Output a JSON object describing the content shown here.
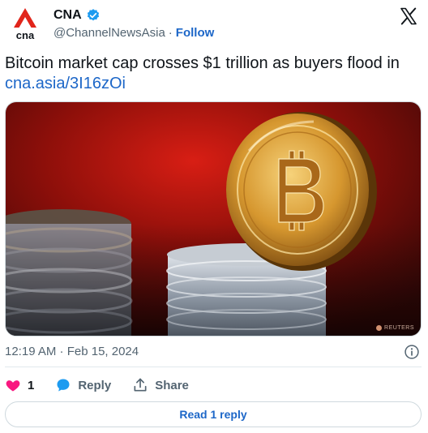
{
  "author": {
    "logo_text": "cna",
    "name": "CNA",
    "handle": "@ChannelNewsAsia",
    "separator": "·",
    "follow_label": "Follow"
  },
  "tweet": {
    "text": "Bitcoin market cap crosses $1 trillion as buyers flood in",
    "link": "cna.asia/3I16zOi"
  },
  "media": {
    "watermark": "REUTERS"
  },
  "meta": {
    "timestamp": "12:19 AM · Feb 15, 2024"
  },
  "actions": {
    "like_count": "1",
    "reply_label": "Reply",
    "share_label": "Share"
  },
  "read_reply_label": "Read 1 reply",
  "colors": {
    "brand_red": "#e1251b",
    "link_blue": "#1d67c8",
    "verified_blue": "#1d9bf0",
    "like_pink": "#f91880",
    "muted_text": "#536471"
  },
  "icons": {
    "brand": "cna-logo-icon",
    "verified": "verified-badge-icon",
    "platform": "x-logo-icon",
    "info": "info-icon",
    "like": "heart-icon",
    "reply": "reply-bubble-icon",
    "share": "share-upload-icon"
  }
}
